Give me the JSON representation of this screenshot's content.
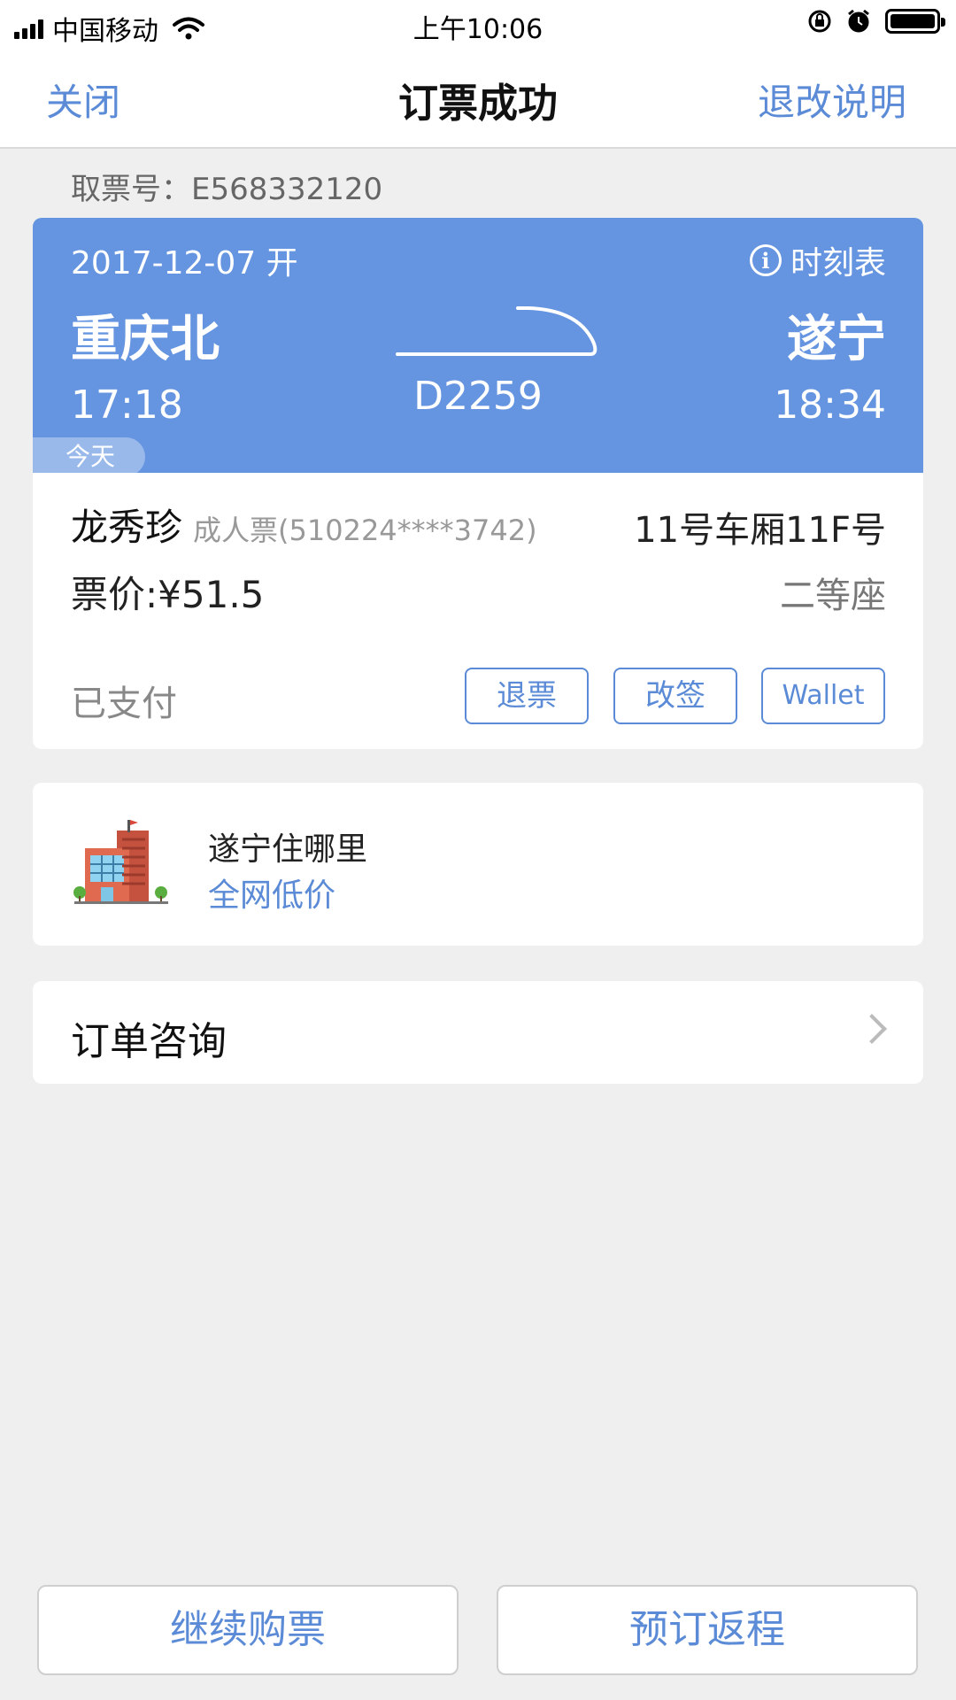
{
  "status_bar": {
    "carrier": "中国移动",
    "time": "上午10:06"
  },
  "nav": {
    "close_label": "关闭",
    "title": "订票成功",
    "refund_policy_label": "退改说明"
  },
  "pickup": {
    "label": "取票号：E568332120"
  },
  "ticket": {
    "date_label": "2017-12-07 开",
    "timetable_label": "时刻表",
    "from_station": "重庆北",
    "to_station": "遂宁",
    "depart_time": "17:18",
    "arrive_time": "18:34",
    "train_number": "D2259",
    "today_tag": "今天",
    "passenger_name": "龙秀珍",
    "passenger_type": "成人票(510224****3742)",
    "seat": "11号车厢11F号",
    "price": "票价:¥51.5",
    "seat_class": "二等座",
    "payment_status": "已支付",
    "buttons": {
      "refund": "退票",
      "change": "改签",
      "wallet": "Wallet"
    }
  },
  "hotel": {
    "title": "遂宁住哪里",
    "subtitle": "全网低价",
    "icon": "hotel-building-icon"
  },
  "consult": {
    "label": "订单咨询"
  },
  "bottom": {
    "continue_label": "继续购票",
    "return_label": "预订返程"
  },
  "colors": {
    "accent": "#5b8bd6",
    "ticket_header": "#6594e0",
    "background": "#efefef"
  }
}
